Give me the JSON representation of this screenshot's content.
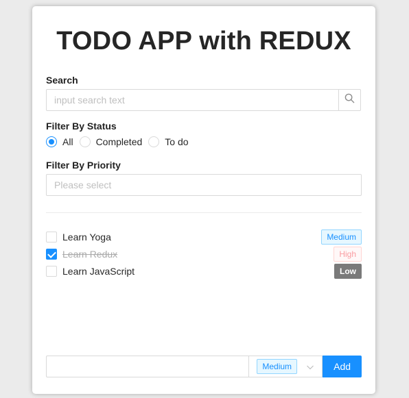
{
  "app": {
    "title": "TODO APP with REDUX"
  },
  "filters": {
    "search_label": "Search",
    "search_placeholder": "input search text",
    "status_label": "Filter By Status",
    "status_options": [
      {
        "label": "All",
        "checked": true
      },
      {
        "label": "Completed",
        "checked": false
      },
      {
        "label": "To do",
        "checked": false
      }
    ],
    "priority_label": "Filter By Priority",
    "priority_placeholder": "Please select"
  },
  "todos": [
    {
      "name": "Learn Yoga",
      "completed": false,
      "priority": "Medium"
    },
    {
      "name": "Learn Redux",
      "completed": true,
      "priority": "High"
    },
    {
      "name": "Learn JavaScript",
      "completed": false,
      "priority": "Low"
    }
  ],
  "add_form": {
    "input_value": "",
    "priority_value": "Medium",
    "add_label": "Add"
  },
  "colors": {
    "accent": "#1890ff",
    "medium": "#1890ff",
    "high": "#f5222d",
    "low": "#7a7a7a"
  },
  "icons": {
    "search": "search-icon",
    "dropdown": "chevron-down-icon",
    "check": "check-icon"
  }
}
